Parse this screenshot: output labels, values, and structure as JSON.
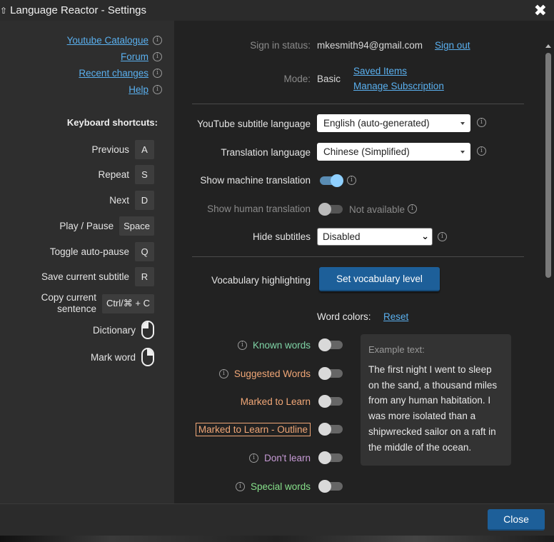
{
  "window": {
    "title": "Language Reactor - Settings",
    "close_glyph": "✖"
  },
  "left": {
    "links": [
      {
        "label": "Youtube Catalogue"
      },
      {
        "label": "Forum"
      },
      {
        "label": "Recent changes"
      },
      {
        "label": "Help"
      }
    ],
    "shortcuts_title": "Keyboard shortcuts:",
    "shortcuts": [
      {
        "label": "Previous",
        "key": "A"
      },
      {
        "label": "Repeat",
        "key": "S"
      },
      {
        "label": "Next",
        "key": "D"
      },
      {
        "label": "Play / Pause",
        "key": "Space"
      },
      {
        "label": "Toggle auto-pause",
        "key": "Q"
      },
      {
        "label": "Save current subtitle",
        "key": "R"
      },
      {
        "label_line1": "Copy current",
        "label_line2": "sentence",
        "key": "Ctrl/⌘ + C"
      },
      {
        "label": "Dictionary",
        "icon": "mouse-left-click-icon"
      },
      {
        "label": "Mark word",
        "icon": "mouse-right-click-icon"
      }
    ]
  },
  "right": {
    "sign_in_label": "Sign in status:",
    "sign_in_email": "mkesmith94@gmail.com",
    "sign_out": "Sign out",
    "mode_label": "Mode:",
    "mode_value": "Basic",
    "saved_items": "Saved Items",
    "manage_subscription": "Manage Subscription",
    "yt_sub_label": "YouTube subtitle language",
    "yt_sub_value": "English (auto-generated)",
    "translation_label": "Translation language",
    "translation_value": "Chinese (Simplified)",
    "machine_label": "Show machine translation",
    "machine_on": true,
    "human_label": "Show human translation",
    "human_note": "Not available",
    "hide_label": "Hide subtitles",
    "hide_value": "Disabled",
    "vocab_label": "Vocabulary highlighting",
    "vocab_button": "Set vocabulary level",
    "word_colors_label": "Word colors:",
    "reset": "Reset",
    "word_colors": [
      {
        "label": "Known words",
        "color": "#7fd4a6",
        "info": true
      },
      {
        "label": "Suggested Words",
        "color": "#f1a777",
        "info": true
      },
      {
        "label": "Marked to Learn",
        "color": "#f1a777",
        "info": false
      },
      {
        "label": "Marked to Learn - Outline",
        "color": "#f1a777",
        "info": false,
        "outline": true
      },
      {
        "label": "Don't learn",
        "color": "#c79bd6",
        "info": true
      },
      {
        "label": "Special words",
        "color": "#86e08a",
        "info": true
      }
    ],
    "example_title": "Example text:",
    "example_text": "The first night I went to sleep on the sand, a thousand miles from any human habitation. I was more isolated than a shipwrecked sailor on a raft in the middle of the ocean."
  },
  "footer": {
    "close": "Close"
  },
  "colors": {
    "accent": "#1d5f99",
    "link": "#5ab0ef",
    "toggle_on": "#8fd0ff"
  }
}
